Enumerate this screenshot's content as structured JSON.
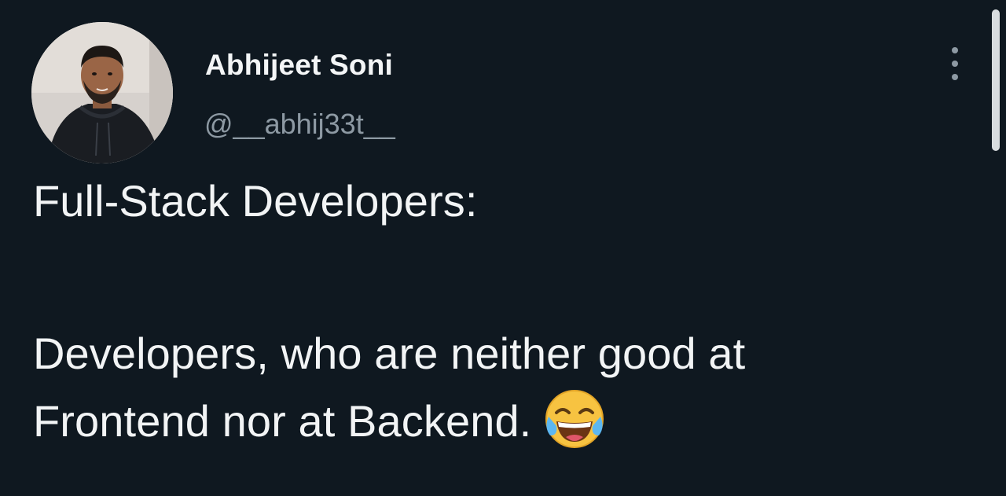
{
  "author": {
    "display_name": "Abhijeet Soni",
    "handle": "@__abhij33t__",
    "avatar_icon": "profile-photo-avatar"
  },
  "menu": {
    "icon": "more-options-icon"
  },
  "tweet": {
    "line1": "Full-Stack Developers:",
    "line2": "Developers, who are neither good at",
    "line3": "Frontend nor at Backend.",
    "emoji_icon": "face-with-tears-of-joy-icon"
  },
  "colors": {
    "background": "#0f1820",
    "primary_text": "#f2f4f5",
    "secondary_text": "#8d99a3"
  }
}
